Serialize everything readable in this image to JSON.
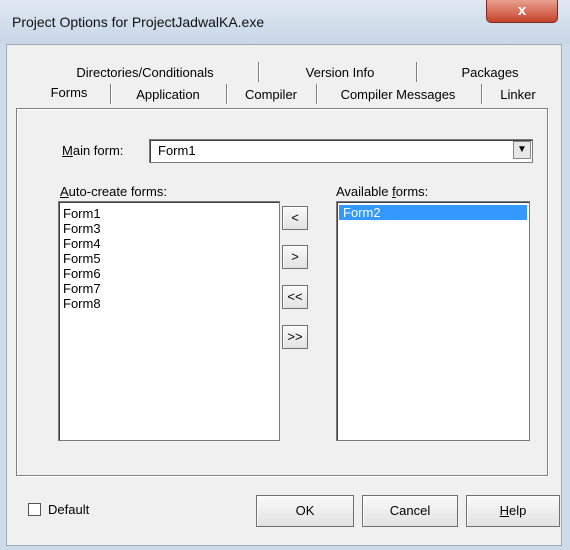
{
  "window": {
    "title": "Project Options for ProjectJadwalKA.exe",
    "close_glyph": "x"
  },
  "tabs_row1": [
    {
      "label": "Directories/Conditionals"
    },
    {
      "label": "Version Info"
    },
    {
      "label": "Packages"
    }
  ],
  "tabs_row2": [
    {
      "label": "Forms",
      "active": true
    },
    {
      "label": "Application"
    },
    {
      "label": "Compiler"
    },
    {
      "label": "Compiler Messages"
    },
    {
      "label": "Linker"
    }
  ],
  "main_form": {
    "label_u": "M",
    "label_rest": "ain form:",
    "value": "Form1"
  },
  "auto_create": {
    "label_u": "A",
    "label_rest": "uto-create forms:",
    "items": [
      "Form1",
      "Form3",
      "Form4",
      "Form5",
      "Form6",
      "Form7",
      "Form8"
    ]
  },
  "available": {
    "label_pre": "Available ",
    "label_u": "f",
    "label_rest": "orms:",
    "items": [
      "Form2"
    ],
    "selected_index": 0
  },
  "move_buttons": {
    "left_one": "<",
    "right_one": ">",
    "left_all": "<<",
    "right_all": ">>"
  },
  "footer": {
    "default_label": "Default",
    "ok": "OK",
    "cancel": "Cancel",
    "help_u": "H",
    "help_rest": "elp"
  },
  "colors": {
    "selection": "#3399ff",
    "close": "#c7432c"
  }
}
